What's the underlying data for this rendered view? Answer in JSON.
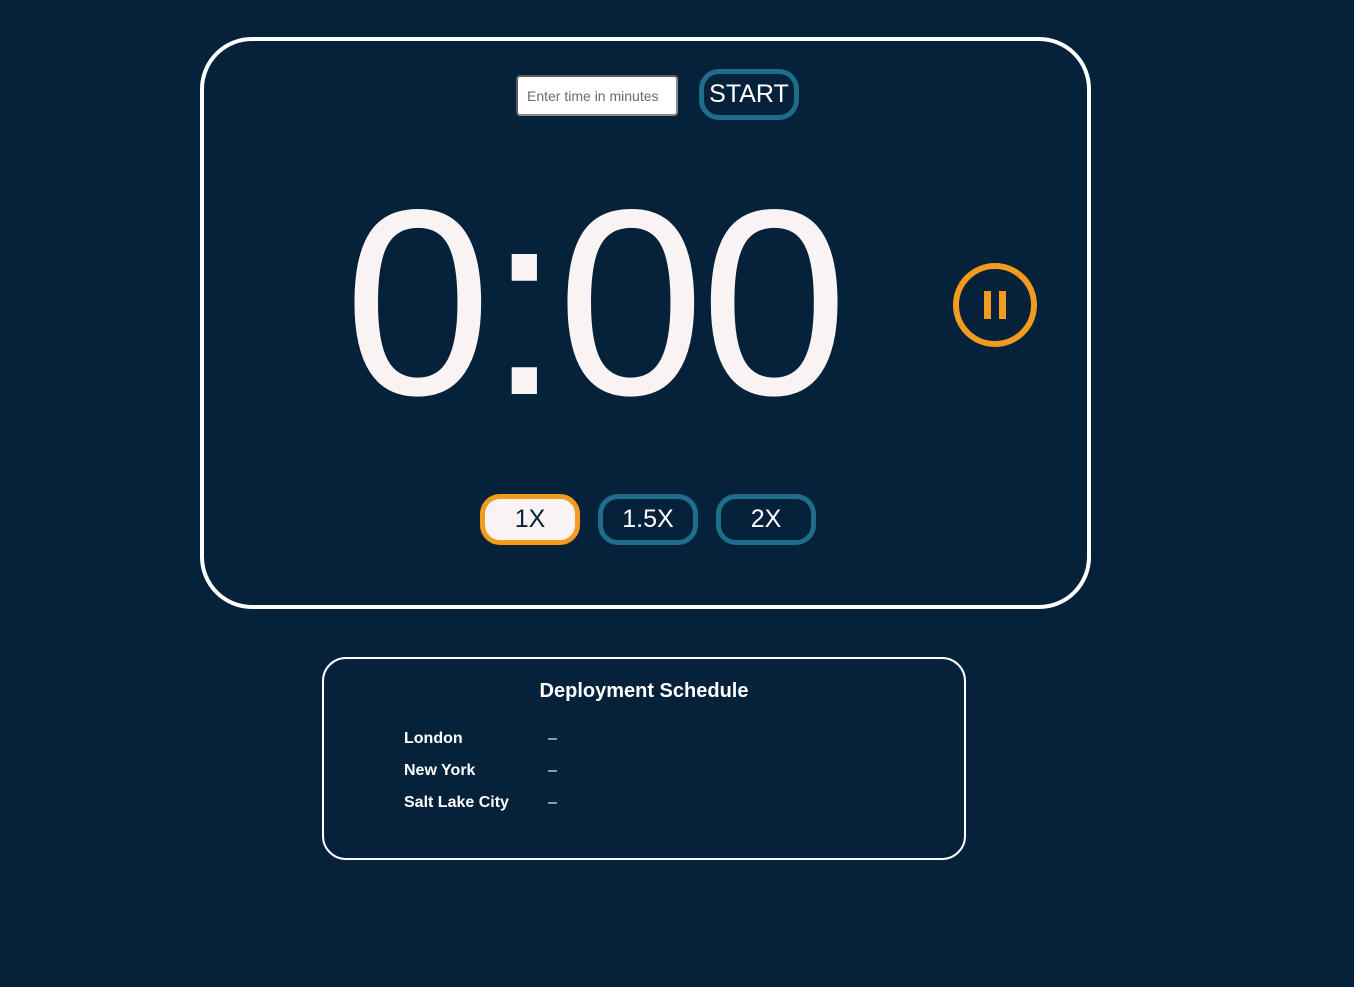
{
  "timer": {
    "input_placeholder": "Enter time in minutes",
    "input_value": "",
    "start_label": "START",
    "display": "0:00",
    "pause_icon": "pause-circle-icon",
    "speeds": [
      {
        "label": "1X",
        "active": true
      },
      {
        "label": "1.5X",
        "active": false
      },
      {
        "label": "2X",
        "active": false
      }
    ]
  },
  "schedule": {
    "title": "Deployment Schedule",
    "rows": [
      {
        "city": "London",
        "value": "–"
      },
      {
        "city": "New York",
        "value": "–"
      },
      {
        "city": "Salt Lake City",
        "value": "–"
      }
    ]
  },
  "colors": {
    "background": "#05223a",
    "accent": "#f29b1f",
    "button_border": "#1e6d8a",
    "text": "#f9f3f3"
  }
}
